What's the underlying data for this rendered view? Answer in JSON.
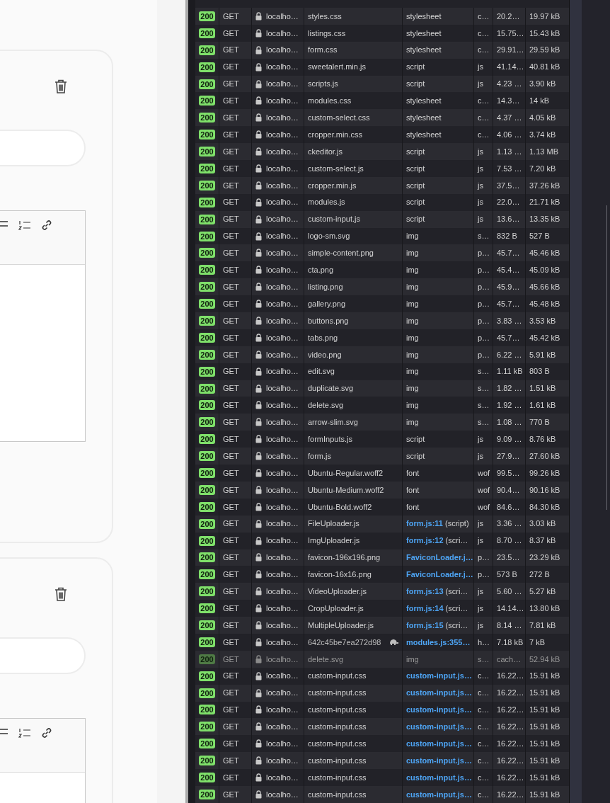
{
  "network_table": {
    "rows": [
      {
        "status": "200",
        "method": "GET",
        "domain": "localho…",
        "file": "styles.css",
        "initiator": {
          "text": "stylesheet"
        },
        "type": "c…",
        "transferred": "20.2…",
        "size": "19.97 kB",
        "kind": "normal"
      },
      {
        "status": "200",
        "method": "GET",
        "domain": "localho…",
        "file": "listings.css",
        "initiator": {
          "text": "stylesheet"
        },
        "type": "c…",
        "transferred": "15.75…",
        "size": "15.43 kB",
        "kind": "normal"
      },
      {
        "status": "200",
        "method": "GET",
        "domain": "localho…",
        "file": "form.css",
        "initiator": {
          "text": "stylesheet"
        },
        "type": "c…",
        "transferred": "29.91…",
        "size": "29.59 kB",
        "kind": "normal"
      },
      {
        "status": "200",
        "method": "GET",
        "domain": "localho…",
        "file": "sweetalert.min.js",
        "initiator": {
          "text": "script"
        },
        "type": "js",
        "transferred": "41.14…",
        "size": "40.81 kB",
        "kind": "normal"
      },
      {
        "status": "200",
        "method": "GET",
        "domain": "localho…",
        "file": "scripts.js",
        "initiator": {
          "text": "script"
        },
        "type": "js",
        "transferred": "4.23 …",
        "size": "3.90 kB",
        "kind": "normal"
      },
      {
        "status": "200",
        "method": "GET",
        "domain": "localho…",
        "file": "modules.css",
        "initiator": {
          "text": "stylesheet"
        },
        "type": "c…",
        "transferred": "14.3…",
        "size": "14 kB",
        "kind": "normal"
      },
      {
        "status": "200",
        "method": "GET",
        "domain": "localho…",
        "file": "custom-select.css",
        "initiator": {
          "text": "stylesheet"
        },
        "type": "c…",
        "transferred": "4.37 …",
        "size": "4.05 kB",
        "kind": "normal"
      },
      {
        "status": "200",
        "method": "GET",
        "domain": "localho…",
        "file": "cropper.min.css",
        "initiator": {
          "text": "stylesheet"
        },
        "type": "c…",
        "transferred": "4.06 …",
        "size": "3.74 kB",
        "kind": "normal"
      },
      {
        "status": "200",
        "method": "GET",
        "domain": "localho…",
        "file": "ckeditor.js",
        "initiator": {
          "text": "script"
        },
        "type": "js",
        "transferred": "1.13 …",
        "size": "1.13 MB",
        "kind": "normal"
      },
      {
        "status": "200",
        "method": "GET",
        "domain": "localho…",
        "file": "custom-select.js",
        "initiator": {
          "text": "script"
        },
        "type": "js",
        "transferred": "7.53 …",
        "size": "7.20 kB",
        "kind": "normal"
      },
      {
        "status": "200",
        "method": "GET",
        "domain": "localho…",
        "file": "cropper.min.js",
        "initiator": {
          "text": "script"
        },
        "type": "js",
        "transferred": "37.5…",
        "size": "37.26 kB",
        "kind": "normal"
      },
      {
        "status": "200",
        "method": "GET",
        "domain": "localho…",
        "file": "modules.js",
        "initiator": {
          "text": "script"
        },
        "type": "js",
        "transferred": "22.0…",
        "size": "21.71 kB",
        "kind": "normal"
      },
      {
        "status": "200",
        "method": "GET",
        "domain": "localho…",
        "file": "custom-input.js",
        "initiator": {
          "text": "script"
        },
        "type": "js",
        "transferred": "13.6…",
        "size": "13.35 kB",
        "kind": "normal"
      },
      {
        "status": "200",
        "method": "GET",
        "domain": "localho…",
        "file": "logo-sm.svg",
        "initiator": {
          "text": "img"
        },
        "type": "s…",
        "transferred": "832 B",
        "size": "527 B",
        "kind": "normal"
      },
      {
        "status": "200",
        "method": "GET",
        "domain": "localho…",
        "file": "simple-content.png",
        "initiator": {
          "text": "img"
        },
        "type": "p…",
        "transferred": "45.7…",
        "size": "45.46 kB",
        "kind": "normal"
      },
      {
        "status": "200",
        "method": "GET",
        "domain": "localho…",
        "file": "cta.png",
        "initiator": {
          "text": "img"
        },
        "type": "p…",
        "transferred": "45.4…",
        "size": "45.09 kB",
        "kind": "normal"
      },
      {
        "status": "200",
        "method": "GET",
        "domain": "localho…",
        "file": "listing.png",
        "initiator": {
          "text": "img"
        },
        "type": "p…",
        "transferred": "45.9…",
        "size": "45.66 kB",
        "kind": "normal"
      },
      {
        "status": "200",
        "method": "GET",
        "domain": "localho…",
        "file": "gallery.png",
        "initiator": {
          "text": "img"
        },
        "type": "p…",
        "transferred": "45.7…",
        "size": "45.48 kB",
        "kind": "normal"
      },
      {
        "status": "200",
        "method": "GET",
        "domain": "localho…",
        "file": "buttons.png",
        "initiator": {
          "text": "img"
        },
        "type": "p…",
        "transferred": "3.83 …",
        "size": "3.53 kB",
        "kind": "normal"
      },
      {
        "status": "200",
        "method": "GET",
        "domain": "localho…",
        "file": "tabs.png",
        "initiator": {
          "text": "img"
        },
        "type": "p…",
        "transferred": "45.7…",
        "size": "45.42 kB",
        "kind": "normal"
      },
      {
        "status": "200",
        "method": "GET",
        "domain": "localho…",
        "file": "video.png",
        "initiator": {
          "text": "img"
        },
        "type": "p…",
        "transferred": "6.22 …",
        "size": "5.91 kB",
        "kind": "normal"
      },
      {
        "status": "200",
        "method": "GET",
        "domain": "localho…",
        "file": "edit.svg",
        "initiator": {
          "text": "img"
        },
        "type": "s…",
        "transferred": "1.11 kB",
        "size": "803 B",
        "kind": "normal"
      },
      {
        "status": "200",
        "method": "GET",
        "domain": "localho…",
        "file": "duplicate.svg",
        "initiator": {
          "text": "img"
        },
        "type": "s…",
        "transferred": "1.82 …",
        "size": "1.51 kB",
        "kind": "normal"
      },
      {
        "status": "200",
        "method": "GET",
        "domain": "localho…",
        "file": "delete.svg",
        "initiator": {
          "text": "img"
        },
        "type": "s…",
        "transferred": "1.92 …",
        "size": "1.61 kB",
        "kind": "normal"
      },
      {
        "status": "200",
        "method": "GET",
        "domain": "localho…",
        "file": "arrow-slim.svg",
        "initiator": {
          "text": "img"
        },
        "type": "s…",
        "transferred": "1.08 …",
        "size": "770 B",
        "kind": "normal"
      },
      {
        "status": "200",
        "method": "GET",
        "domain": "localho…",
        "file": "formInputs.js",
        "initiator": {
          "text": "script"
        },
        "type": "js",
        "transferred": "9.09 …",
        "size": "8.76 kB",
        "kind": "normal"
      },
      {
        "status": "200",
        "method": "GET",
        "domain": "localho…",
        "file": "form.js",
        "initiator": {
          "text": "script"
        },
        "type": "js",
        "transferred": "27.9…",
        "size": "27.60 kB",
        "kind": "normal"
      },
      {
        "status": "200",
        "method": "GET",
        "domain": "localho…",
        "file": "Ubuntu-Regular.woff2",
        "initiator": {
          "text": "font"
        },
        "type": "wof",
        "transferred": "99.5…",
        "size": "99.26 kB",
        "kind": "normal"
      },
      {
        "status": "200",
        "method": "GET",
        "domain": "localho…",
        "file": "Ubuntu-Medium.woff2",
        "initiator": {
          "text": "font"
        },
        "type": "wof",
        "transferred": "90.4…",
        "size": "90.16 kB",
        "kind": "normal"
      },
      {
        "status": "200",
        "method": "GET",
        "domain": "localho…",
        "file": "Ubuntu-Bold.woff2",
        "initiator": {
          "text": "font"
        },
        "type": "wof",
        "transferred": "84.6…",
        "size": "84.30 kB",
        "kind": "normal"
      },
      {
        "status": "200",
        "method": "GET",
        "domain": "localho…",
        "file": "FileUploader.js",
        "initiator": {
          "link": "form.js:11",
          "text": "(script)"
        },
        "type": "js",
        "transferred": "3.36 …",
        "size": "3.03 kB",
        "kind": "normal"
      },
      {
        "status": "200",
        "method": "GET",
        "domain": "localho…",
        "file": "ImgUploader.js",
        "initiator": {
          "link": "form.js:12",
          "text": "(scri…"
        },
        "type": "js",
        "transferred": "8.70 …",
        "size": "8.37 kB",
        "kind": "normal"
      },
      {
        "status": "200",
        "method": "GET",
        "domain": "localho…",
        "file": "favicon-196x196.png",
        "initiator": {
          "link": "FaviconLoader.j…"
        },
        "type": "p…",
        "transferred": "23.5…",
        "size": "23.29 kB",
        "kind": "normal"
      },
      {
        "status": "200",
        "method": "GET",
        "domain": "localho…",
        "file": "favicon-16x16.png",
        "initiator": {
          "link": "FaviconLoader.j…"
        },
        "type": "p…",
        "transferred": "573 B",
        "size": "272 B",
        "kind": "normal"
      },
      {
        "status": "200",
        "method": "GET",
        "domain": "localho…",
        "file": "VideoUploader.js",
        "initiator": {
          "link": "form.js:13",
          "text": "(scri…"
        },
        "type": "js",
        "transferred": "5.60 …",
        "size": "5.27 kB",
        "kind": "normal"
      },
      {
        "status": "200",
        "method": "GET",
        "domain": "localho…",
        "file": "CropUploader.js",
        "initiator": {
          "link": "form.js:14",
          "text": "(scri…"
        },
        "type": "js",
        "transferred": "14.14…",
        "size": "13.80 kB",
        "kind": "normal"
      },
      {
        "status": "200",
        "method": "GET",
        "domain": "localho…",
        "file": "MultipleUploader.js",
        "initiator": {
          "link": "form.js:15",
          "text": "(scri…"
        },
        "type": "js",
        "transferred": "8.14 …",
        "size": "7.81 kB",
        "kind": "normal"
      },
      {
        "status": "200",
        "method": "GET",
        "domain": "localho…",
        "file": "642c45be7ea272d98",
        "initiator": {
          "link": "modules.js:355…"
        },
        "type": "h…",
        "transferred": "7.18 kB",
        "size": "7 kB",
        "kind": "throttled"
      },
      {
        "status": "200",
        "method": "GET",
        "domain": "localho…",
        "file": "delete.svg",
        "initiator": {
          "text": "img"
        },
        "type": "s…",
        "transferred": "cach…",
        "size": "52.94 kB",
        "kind": "cached"
      },
      {
        "status": "200",
        "method": "GET",
        "domain": "localho…",
        "file": "custom-input.css",
        "initiator": {
          "link": "custom-input.js…"
        },
        "type": "c…",
        "transferred": "16.22…",
        "size": "15.91 kB",
        "kind": "normal"
      },
      {
        "status": "200",
        "method": "GET",
        "domain": "localho…",
        "file": "custom-input.css",
        "initiator": {
          "link": "custom-input.js…"
        },
        "type": "c…",
        "transferred": "16.22…",
        "size": "15.91 kB",
        "kind": "normal"
      },
      {
        "status": "200",
        "method": "GET",
        "domain": "localho…",
        "file": "custom-input.css",
        "initiator": {
          "link": "custom-input.js…"
        },
        "type": "c…",
        "transferred": "16.22…",
        "size": "15.91 kB",
        "kind": "normal"
      },
      {
        "status": "200",
        "method": "GET",
        "domain": "localho…",
        "file": "custom-input.css",
        "initiator": {
          "link": "custom-input.js…"
        },
        "type": "c…",
        "transferred": "16.22…",
        "size": "15.91 kB",
        "kind": "normal"
      },
      {
        "status": "200",
        "method": "GET",
        "domain": "localho…",
        "file": "custom-input.css",
        "initiator": {
          "link": "custom-input.js…"
        },
        "type": "c…",
        "transferred": "16.22…",
        "size": "15.91 kB",
        "kind": "normal"
      },
      {
        "status": "200",
        "method": "GET",
        "domain": "localho…",
        "file": "custom-input.css",
        "initiator": {
          "link": "custom-input.js…"
        },
        "type": "c…",
        "transferred": "16.22…",
        "size": "15.91 kB",
        "kind": "normal"
      },
      {
        "status": "200",
        "method": "GET",
        "domain": "localho…",
        "file": "custom-input.css",
        "initiator": {
          "link": "custom-input.js…"
        },
        "type": "c…",
        "transferred": "16.22…",
        "size": "15.91 kB",
        "kind": "normal"
      },
      {
        "status": "200",
        "method": "GET",
        "domain": "localho…",
        "file": "custom-input.css",
        "initiator": {
          "link": "custom-input.js…"
        },
        "type": "c…",
        "transferred": "16.22…",
        "size": "15.91 kB",
        "kind": "normal"
      }
    ]
  }
}
